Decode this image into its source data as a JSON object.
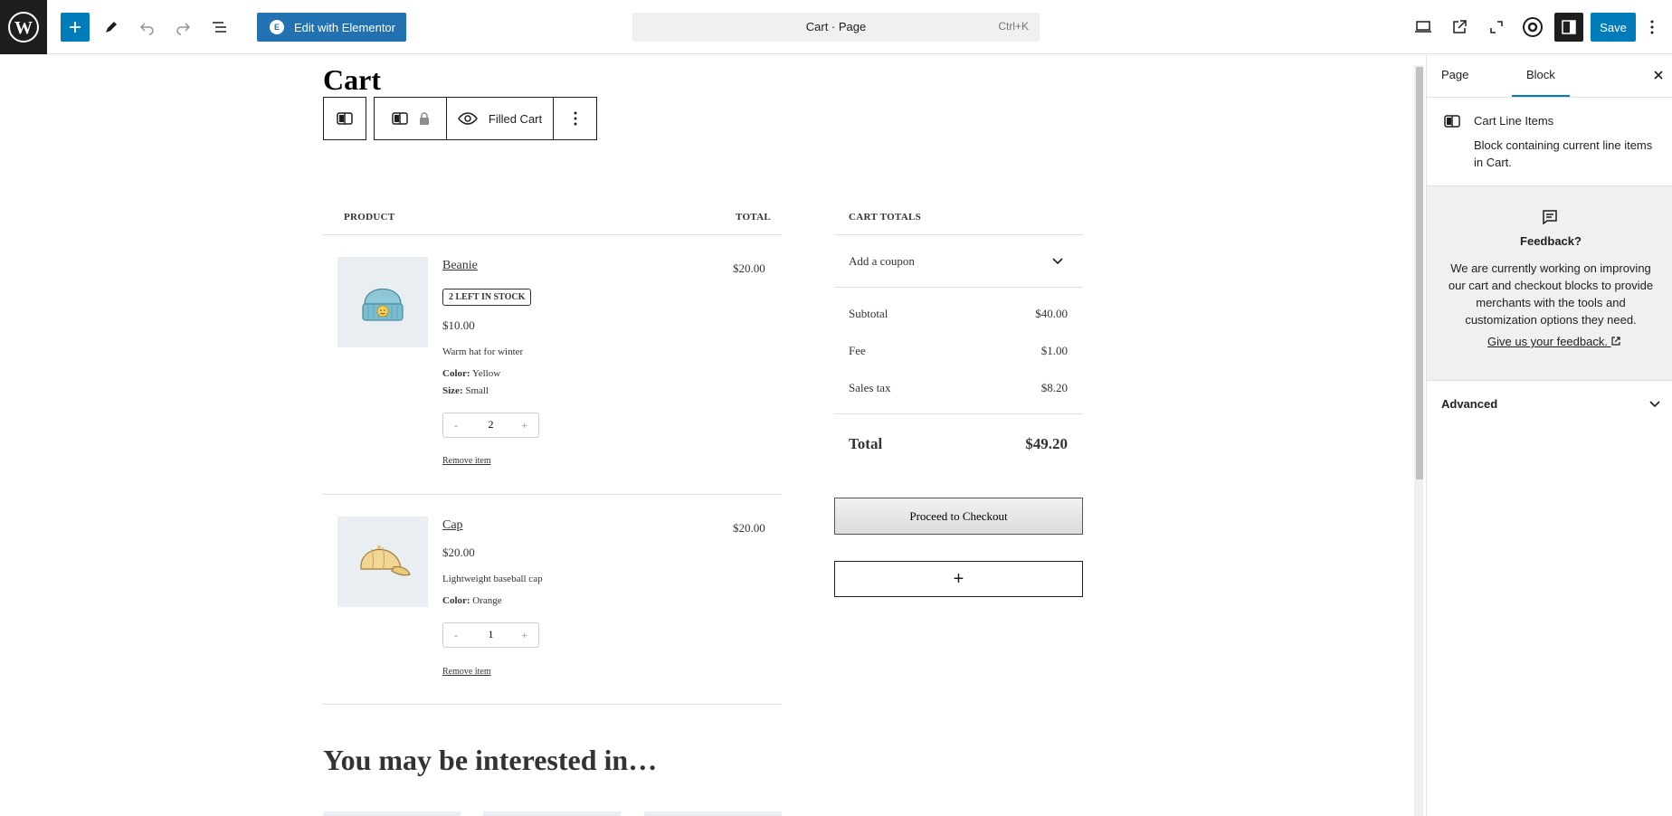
{
  "topbar": {
    "elementor_label": "Edit with Elementor",
    "command_title": "Cart · Page",
    "command_shortcut": "Ctrl+K",
    "save_label": "Save"
  },
  "canvas": {
    "page_title": "Cart",
    "block_toolbar": {
      "filled_label": "Filled Cart"
    },
    "columns": {
      "product": "PRODUCT",
      "total": "TOTAL",
      "cart_totals": "CART TOTALS"
    },
    "items": [
      {
        "name": "Beanie",
        "stock_badge": "2 LEFT IN STOCK",
        "unit_price": "$10.00",
        "description": "Warm hat for winter",
        "attributes": [
          {
            "label": "Color:",
            "value": "Yellow"
          },
          {
            "label": "Size:",
            "value": "Small"
          }
        ],
        "quantity": "2",
        "qty_minus": "-",
        "qty_plus": "+",
        "remove_label": "Remove item",
        "line_total": "$20.00"
      },
      {
        "name": "Cap",
        "unit_price": "$20.00",
        "description": "Lightweight baseball cap",
        "attributes": [
          {
            "label": "Color:",
            "value": "Orange"
          }
        ],
        "quantity": "1",
        "qty_minus": "-",
        "qty_plus": "+",
        "remove_label": "Remove item",
        "line_total": "$20.00"
      }
    ],
    "totals": {
      "coupon_label": "Add a coupon",
      "subtotal_label": "Subtotal",
      "subtotal_value": "$40.00",
      "fee_label": "Fee",
      "fee_value": "$1.00",
      "tax_label": "Sales tax",
      "tax_value": "$8.20",
      "total_label": "Total",
      "total_value": "$49.20",
      "checkout_label": "Proceed to Checkout",
      "appender_label": "+"
    },
    "interested_title": "You may be interested in…"
  },
  "sidebar": {
    "tab_page": "Page",
    "tab_block": "Block",
    "block_name": "Cart Line Items",
    "block_description": "Block containing current line items in Cart.",
    "feedback_title": "Feedback?",
    "feedback_text": "We are currently working on improving our cart and checkout blocks to provide merchants with the tools and customization options they need.",
    "feedback_link": "Give us your feedback.",
    "advanced_label": "Advanced"
  },
  "colors": {
    "accent": "#007cba",
    "elementor": "#2271b1",
    "dark": "#1e1e1e"
  }
}
